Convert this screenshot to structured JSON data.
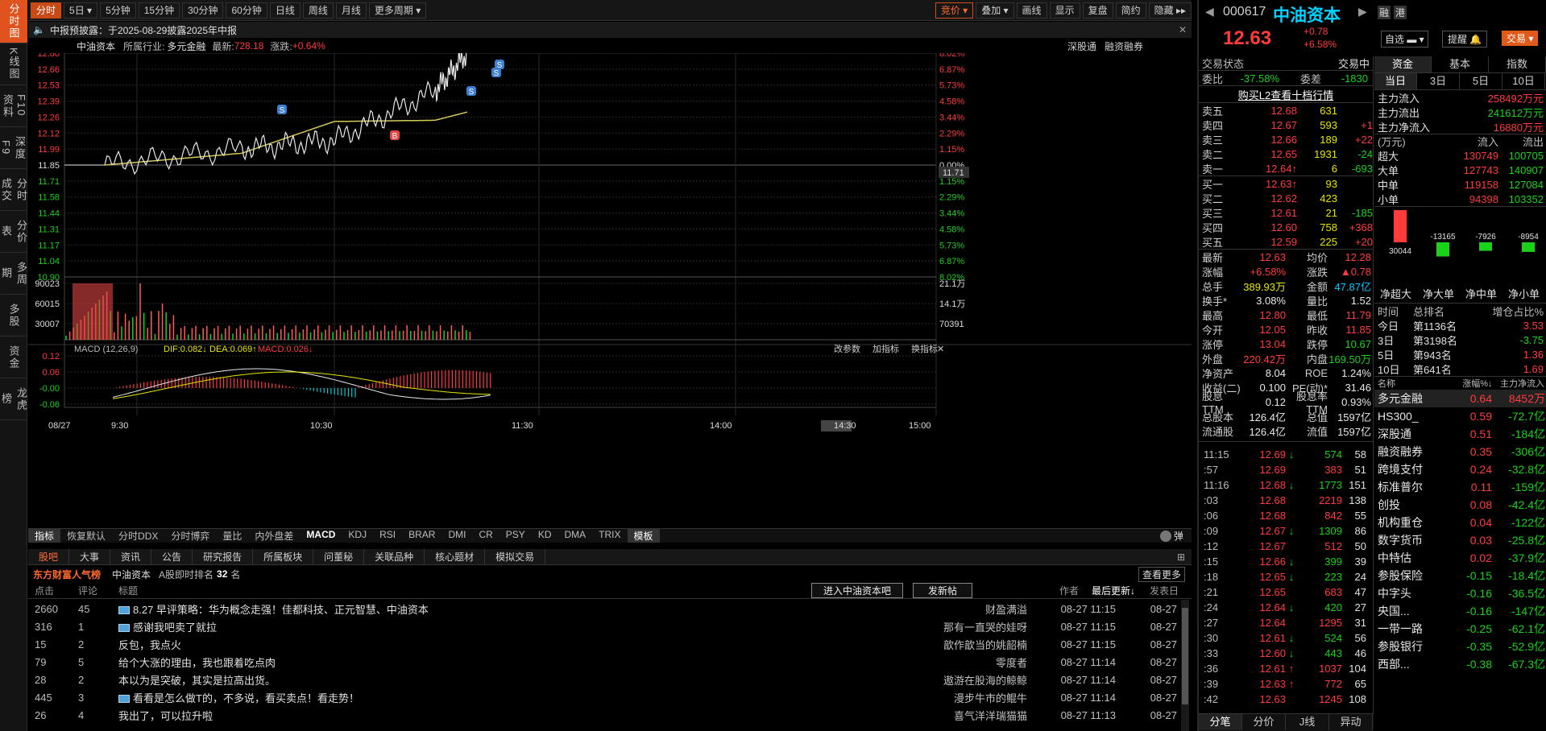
{
  "left_tabs": [
    "分时图",
    "K线图",
    "F10资料",
    "深度F9",
    "分时成交",
    "分价表",
    "多周期",
    "多股",
    "资金",
    "龙虎榜"
  ],
  "toolbar": {
    "items": [
      "分时",
      "5日",
      "5分钟",
      "15分钟",
      "30分钟",
      "60分钟",
      "日线",
      "周线",
      "月线",
      "更多周期"
    ],
    "right": [
      "竞价",
      "叠加",
      "画线",
      "显示",
      "复盘",
      "简约",
      "隐藏"
    ]
  },
  "notice": "中报预披露：于2025-08-29披露2025年中报",
  "info": {
    "name": "中油资本",
    "industry_label": "所属行业:",
    "industry": "多元金融",
    "latest_label": "最新:",
    "latest": "728.18",
    "change_label": "涨跌:",
    "change": "+0.64%",
    "right1": "深股通",
    "right2": "融资融券"
  },
  "price_axis": [
    "12.80",
    "12.66",
    "12.53",
    "12.39",
    "12.26",
    "12.12",
    "11.99",
    "11.85",
    "11.71",
    "11.58",
    "11.44",
    "11.31",
    "11.17",
    "11.04",
    "10.90"
  ],
  "pct_axis": [
    "8.02%",
    "6.87%",
    "5.73%",
    "4.58%",
    "3.44%",
    "2.29%",
    "1.15%",
    "0.00%",
    "1.15%",
    "2.29%",
    "3.44%",
    "4.58%",
    "5.73%",
    "6.87%",
    "8.02%"
  ],
  "cursor_price": "11.71",
  "vol_axis": [
    "90023",
    "60015",
    "30007"
  ],
  "vol_axis_right": [
    "21.1万",
    "14.1万",
    "70391"
  ],
  "macd": {
    "title": "MACD (12,26,9)",
    "dif": "DIF:0.082↓",
    "dea": "DEA:0.069↑",
    "macd": "MACD:0.026↓",
    "axis": [
      "0.12",
      "0.06",
      "-0.00",
      "-0.06"
    ],
    "btns": [
      "改参数",
      "加指标",
      "换指标"
    ]
  },
  "time_axis": [
    "08/27",
    "9:30",
    "10:30",
    "11:30",
    "14:00",
    "14:30",
    "15:00"
  ],
  "chart_data": {
    "type": "line",
    "title": "",
    "x": [
      "9:30",
      "10:00",
      "10:30",
      "11:00",
      "11:15"
    ],
    "series": [
      {
        "name": "",
        "values": [
          11.85,
          11.99,
          12.06,
          12.48,
          12.8
        ]
      },
      {
        "name": "",
        "values": [
          11.85,
          11.95,
          12.22,
          12.23,
          12.3
        ]
      }
    ],
    "ylim": [
      10.9,
      12.8
    ]
  },
  "indicators": [
    "指标",
    "恢复默认",
    "分时DDX",
    "分时博弈",
    "量比",
    "内外盘差",
    "MACD",
    "KDJ",
    "RSI",
    "BRAR",
    "DMI",
    "CR",
    "PSY",
    "KD",
    "DMA",
    "TRIX",
    "模板"
  ],
  "toggle_label": "弹",
  "forum": {
    "tabs": [
      "股吧",
      "大事",
      "资讯",
      "公告",
      "研究报告",
      "所属板块",
      "问董秘",
      "关联品种",
      "核心题材",
      "模拟交易"
    ],
    "brand": "东方财富人气榜",
    "stock": "中油资本",
    "rank_label": "A股即时排名",
    "rank": "32",
    "rank_unit": "名",
    "more": "查看更多",
    "enter_btn": "进入中油资本吧",
    "post_btn": "发新帖",
    "cols": [
      "点击",
      "评论",
      "标题",
      "作者",
      "最后更新↓",
      "发表日"
    ],
    "rows": [
      {
        "clicks": "2660",
        "comments": "45",
        "img": true,
        "title": "8.27 早评策略：华为概念走强！佳都科技、正元智慧、中油资本",
        "author": "财盈满溢",
        "updated": "08-27 11:15",
        "date": "08-27"
      },
      {
        "clicks": "316",
        "comments": "1",
        "img": true,
        "title": "感谢我吧卖了就拉",
        "author": "那有一直哭的娃呀",
        "updated": "08-27 11:15",
        "date": "08-27"
      },
      {
        "clicks": "15",
        "comments": "2",
        "img": false,
        "title": "反包，我点火",
        "author": "歆作歆当的姚韶楠",
        "updated": "08-27 11:15",
        "date": "08-27"
      },
      {
        "clicks": "79",
        "comments": "5",
        "img": false,
        "title": "给个大涨的理由，我也跟着吃点肉",
        "author": "零度者",
        "updated": "08-27 11:14",
        "date": "08-27"
      },
      {
        "clicks": "28",
        "comments": "2",
        "img": false,
        "title": "本以为是突破，其实是拉高出货。",
        "author": "遨游在股海的鲸鲸",
        "updated": "08-27 11:14",
        "date": "08-27"
      },
      {
        "clicks": "445",
        "comments": "3",
        "img": true,
        "title": "看看是怎么做T的，不多说，看买卖点！看走势！",
        "author": "漫步牛市的鲲牛",
        "updated": "08-27 11:14",
        "date": "08-27"
      },
      {
        "clicks": "26",
        "comments": "4",
        "img": false,
        "title": "我出了，可以拉升啦",
        "author": "喜气洋洋瑞猫猫",
        "updated": "08-27 11:13",
        "date": "08-27"
      }
    ]
  },
  "quote": {
    "code": "000617",
    "name": "中油资本",
    "tag1": "融",
    "tag2": "港",
    "price": "12.63",
    "chg": "+0.78",
    "pct": "+6.58%",
    "btn_watch": "自选",
    "btn_alert": "提醒",
    "btn_trade": "交易",
    "status_label": "交易状态",
    "status": "交易中",
    "weibi_label": "委比",
    "weibi": "-37.58%",
    "weicha_label": "委差",
    "weicha": "-1830",
    "l2": "购买L2查看十档行情",
    "asks": [
      {
        "l": "卖五",
        "p": "12.68",
        "v": "631",
        "d": ""
      },
      {
        "l": "卖四",
        "p": "12.67",
        "v": "593",
        "d": "+1"
      },
      {
        "l": "卖三",
        "p": "12.66",
        "v": "189",
        "d": "+22"
      },
      {
        "l": "卖二",
        "p": "12.65",
        "v": "1931",
        "d": "-24"
      },
      {
        "l": "卖一",
        "p": "12.64↑",
        "v": "6",
        "d": "-693"
      }
    ],
    "bids": [
      {
        "l": "买一",
        "p": "12.63↑",
        "v": "93",
        "d": ""
      },
      {
        "l": "买二",
        "p": "12.62",
        "v": "423",
        "d": ""
      },
      {
        "l": "买三",
        "p": "12.61",
        "v": "21",
        "d": "-185"
      },
      {
        "l": "买四",
        "p": "12.60",
        "v": "758",
        "d": "+368"
      },
      {
        "l": "买五",
        "p": "12.59",
        "v": "225",
        "d": "+20"
      }
    ],
    "stats": [
      [
        "最新",
        "12.63",
        "均价",
        "12.28"
      ],
      [
        "涨幅",
        "+6.58%",
        "涨跌",
        "▲0.78"
      ],
      [
        "总手",
        "389.93万",
        "金额",
        "47.87亿"
      ],
      [
        "换手*",
        "3.08%",
        "量比",
        "1.52"
      ],
      [
        "最高",
        "12.80",
        "最低",
        "11.79"
      ],
      [
        "今开",
        "12.05",
        "昨收",
        "11.85"
      ],
      [
        "涨停",
        "13.04",
        "跌停",
        "10.67"
      ],
      [
        "外盘",
        "220.42万",
        "内盘",
        "169.50万"
      ],
      [
        "净资产",
        "8.04",
        "ROE",
        "1.24%"
      ],
      [
        "收益(二)",
        "0.100",
        "PE(动)*",
        "31.46"
      ],
      [
        "股息TTM",
        "0.12",
        "股息率TTM",
        "0.93%"
      ],
      [
        "总股本",
        "126.4亿",
        "总值",
        "1597亿"
      ],
      [
        "流通股",
        "126.4亿",
        "流值",
        "1597亿"
      ]
    ],
    "ticks": [
      {
        "t": "11:15",
        "p": "12.69",
        "a": "↓",
        "v": "574",
        "n": "58"
      },
      {
        "t": ":57",
        "p": "12.69",
        "a": "",
        "v": "383",
        "n": "51"
      },
      {
        "t": "11:16",
        "p": "12.68",
        "a": "↓",
        "v": "1773",
        "n": "151"
      },
      {
        "t": ":03",
        "p": "12.68",
        "a": "",
        "v": "2219",
        "n": "138"
      },
      {
        "t": ":06",
        "p": "12.68",
        "a": "",
        "v": "842",
        "n": "55"
      },
      {
        "t": ":09",
        "p": "12.67",
        "a": "↓",
        "v": "1309",
        "n": "86"
      },
      {
        "t": ":12",
        "p": "12.67",
        "a": "",
        "v": "512",
        "n": "50"
      },
      {
        "t": ":15",
        "p": "12.66",
        "a": "↓",
        "v": "399",
        "n": "39"
      },
      {
        "t": ":18",
        "p": "12.65",
        "a": "↓",
        "v": "223",
        "n": "24"
      },
      {
        "t": ":21",
        "p": "12.65",
        "a": "",
        "v": "683",
        "n": "47"
      },
      {
        "t": ":24",
        "p": "12.64",
        "a": "↓",
        "v": "420",
        "n": "27"
      },
      {
        "t": ":27",
        "p": "12.64",
        "a": "",
        "v": "1295",
        "n": "31"
      },
      {
        "t": ":30",
        "p": "12.61",
        "a": "↓",
        "v": "524",
        "n": "56"
      },
      {
        "t": ":33",
        "p": "12.60",
        "a": "↓",
        "v": "443",
        "n": "46"
      },
      {
        "t": ":36",
        "p": "12.61",
        "a": "↑",
        "v": "1037",
        "n": "104"
      },
      {
        "t": ":39",
        "p": "12.63",
        "a": "↑",
        "v": "772",
        "n": "65"
      },
      {
        "t": ":42",
        "p": "12.63",
        "a": "",
        "v": "1245",
        "n": "108"
      }
    ],
    "bottom_tabs": [
      "分笔",
      "分价",
      "J线",
      "异动"
    ]
  },
  "fund": {
    "tabs": [
      "资金",
      "基本",
      "指数"
    ],
    "sub": [
      "当日",
      "3日",
      "5日",
      "10日"
    ],
    "main": [
      [
        "主力流入",
        "258492万元"
      ],
      [
        "主力流出",
        "241612万元"
      ],
      [
        "主力净流入",
        "16880万元"
      ]
    ],
    "unit": "(万元)",
    "in": "流入",
    "out": "流出",
    "rows": [
      [
        "超大",
        "130749",
        "100705"
      ],
      [
        "大单",
        "127743",
        "140907"
      ],
      [
        "中单",
        "119158",
        "127084"
      ],
      [
        "小单",
        "94398",
        "103352"
      ]
    ],
    "bar_values": [
      "30044",
      "-13165",
      "-7926",
      "-8954"
    ],
    "bar_labels": [
      "净超大",
      "净大单",
      "净中单",
      "净小单"
    ],
    "rank_head": [
      "时间",
      "总排名",
      "增仓占比%"
    ],
    "ranks": [
      [
        "今日",
        "第1136名",
        "3.53"
      ],
      [
        "3日",
        "第3198名",
        "-3.75"
      ],
      [
        "5日",
        "第943名",
        "1.36"
      ],
      [
        "10日",
        "第641名",
        "1.69"
      ]
    ],
    "sec_head": [
      "名称",
      "涨幅%↓",
      "主力净流入"
    ],
    "sectors": [
      [
        "多元金融",
        "0.64",
        "8452万"
      ],
      [
        "HS300_",
        "0.59",
        "-72.7亿"
      ],
      [
        "深股通",
        "0.51",
        "-184亿"
      ],
      [
        "融资融券",
        "0.35",
        "-306亿"
      ],
      [
        "跨境支付",
        "0.24",
        "-32.8亿"
      ],
      [
        "标准普尔",
        "0.11",
        "-159亿"
      ],
      [
        "创投",
        "0.08",
        "-42.4亿"
      ],
      [
        "机构重仓",
        "0.04",
        "-122亿"
      ],
      [
        "数字货币",
        "0.03",
        "-25.8亿"
      ],
      [
        "中特估",
        "0.02",
        "-37.9亿"
      ],
      [
        "参股保险",
        "-0.15",
        "-18.4亿"
      ],
      [
        "中字头",
        "-0.16",
        "-36.5亿"
      ],
      [
        "央国...",
        "-0.16",
        "-147亿"
      ],
      [
        "一带一路",
        "-0.25",
        "-62.1亿"
      ],
      [
        "参股银行",
        "-0.35",
        "-52.9亿"
      ],
      [
        "西部...",
        "-0.38",
        "-67.3亿"
      ]
    ]
  }
}
